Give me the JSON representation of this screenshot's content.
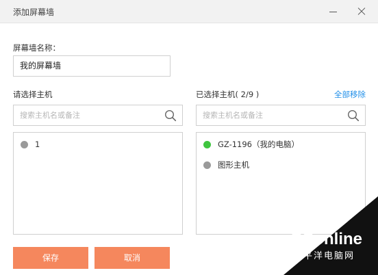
{
  "window": {
    "title": "添加屏幕墙"
  },
  "form": {
    "name_label": "屏幕墙名称：",
    "name_value": "我的屏幕墙",
    "left_label": "请选择主机",
    "right_label": "已选择主机( 2/9 )",
    "remove_all": "全部移除",
    "search_placeholder_left": "搜索主机名或备注",
    "search_placeholder_right": "搜索主机名或备注"
  },
  "available_hosts": [
    {
      "name": "1",
      "status_color": "#9a9a9a"
    }
  ],
  "selected_hosts": [
    {
      "name": "GZ-1196（我的电脑）",
      "status_color": "#3fc53f"
    },
    {
      "name": "图形主机",
      "status_color": "#9a9a9a"
    }
  ],
  "buttons": {
    "save": "保存",
    "cancel": "取消"
  },
  "watermark": {
    "brand": "PConline",
    "subtitle": "太平洋电脑网"
  },
  "icons": {
    "search": "search-icon",
    "minimize": "minimize-icon",
    "close": "close-icon"
  },
  "colors": {
    "accent": "#f5875d",
    "link": "#1e8ee8",
    "online": "#3fc53f",
    "offline": "#9a9a9a"
  }
}
